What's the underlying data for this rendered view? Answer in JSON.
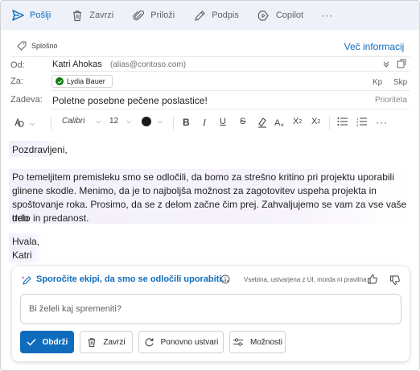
{
  "toolbar": {
    "send_label": "Pošlji",
    "discard_label": "Zavrzi",
    "attach_label": "Priloži",
    "sign_label": "Podpis",
    "copilot_label": "Copilot",
    "more_label": "···"
  },
  "header": {
    "sensitivity": "Splošno",
    "more_info": "Več informacij",
    "from_label": "Od:",
    "from_name": "Katri Ahokas",
    "from_alias": "(alias@contoso.com)",
    "to_label": "Za:",
    "to_recipient": "Lydia Bauer",
    "cc_label": "Kp",
    "bcc_label": "Skp",
    "subject_label": "Zadeva:",
    "subject": "Poletne posebne pečene poslastice!",
    "priority_label": "Prioriteta"
  },
  "format": {
    "font": "Calibri",
    "size": "12",
    "text_color": "#1a1a1a"
  },
  "body": {
    "greeting": "Pozdravljeni,",
    "paragraph_lines": [
      "Po temeljitem premisleku smo se odločili, da bomo za strešno kritino pri projektu uporabili",
      "glinene skodle. Menimo, da je to najboljša možnost za zagotovitev uspeha projekta in",
      "spoštovanje roka. Prosimo, da se z delom začne čim prej. Zahvaljujemo se vam za vse vaše trdo",
      "delo in predanost."
    ],
    "closing": "Hvala,",
    "signature": "Katri"
  },
  "copilot": {
    "title": "Sporočite ekipi, da smo se odločili uporabiti...",
    "disclaimer": "Vsebina, ustvarjena z UI, morda ni pravilna",
    "input_placeholder": "Bi želeli kaj spremeniti?",
    "keep_label": "Obdrži",
    "discard_label": "Zavrzi",
    "regenerate_label": "Ponovno ustvari",
    "options_label": "Možnosti"
  },
  "colors": {
    "accent": "#0f6cbd",
    "toolbar_bg": "#eef2f8",
    "highlight": "#f2f0fb",
    "success": "#107c10"
  }
}
